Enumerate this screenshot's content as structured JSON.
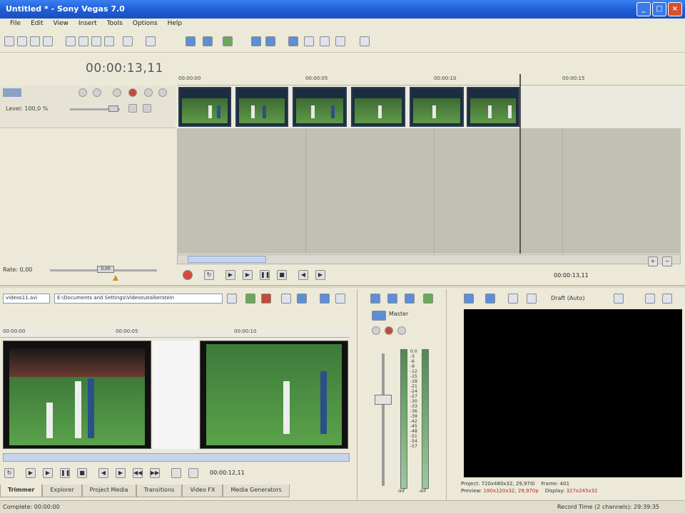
{
  "window": {
    "title": "Untitled * - Sony Vegas 7.0"
  },
  "menu": [
    "File",
    "Edit",
    "View",
    "Insert",
    "Tools",
    "Options",
    "Help"
  ],
  "timeline": {
    "cursor_time": "00:00:13,11",
    "ruler_ticks": [
      "00:00:00",
      "00:00:05",
      "00:00:10",
      "00:00:15"
    ],
    "track_level": "Level: 100,0 %",
    "rate_label": "Rate: 0,00",
    "rate_value": "0,00",
    "end_time": "00:00:13,11"
  },
  "explorer": {
    "file_combo": "videos11.avi",
    "path_combo": "E:\\Documents and Settings\\Videos\\stalkerstein",
    "trim_ticks": [
      "00:00:00",
      "00:00:05",
      "00:00:10"
    ],
    "trim_time": "00:00:12,11",
    "tabs": [
      "Trimmer",
      "Explorer",
      "Project Media",
      "Transitions",
      "Video FX",
      "Media Generators"
    ]
  },
  "mixer": {
    "master_label": "Master",
    "scale": [
      "0.0",
      "-3",
      "-6",
      "-9",
      "-12",
      "-15",
      "-18",
      "-21",
      "-24",
      "-27",
      "-30",
      "-33",
      "-36",
      "-39",
      "-42",
      "-45",
      "-48",
      "-51",
      "-54",
      "-57"
    ],
    "bottom_left": "-Inf",
    "bottom_right": "-Inf"
  },
  "preview": {
    "quality": "Draft (Auto)",
    "project_label": "Project:",
    "project_value": "720x480x32, 29,970i",
    "preview_label": "Preview:",
    "preview_value": "180x120x32, 29,970p",
    "frame_label": "Frame:",
    "frame_value": "401",
    "display_label": "Display:",
    "display_value": "327x245x32"
  },
  "status": {
    "left": "Complete: 00:00:00",
    "right": "Record Time (2 channels): 29:39:35"
  }
}
